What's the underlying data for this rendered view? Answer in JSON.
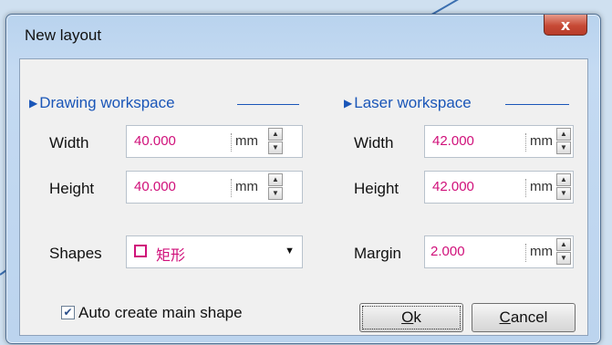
{
  "dialog": {
    "title": "New layout",
    "close_glyph": "x"
  },
  "drawing": {
    "section_label": "Drawing workspace",
    "width_label": "Width",
    "width_value": "40.000",
    "height_label": "Height",
    "height_value": "40.000",
    "unit": "mm",
    "shapes_label": "Shapes",
    "shapes_value": "矩形"
  },
  "laser": {
    "section_label": "Laser workspace",
    "width_label": "Width",
    "width_value": "42.000",
    "height_label": "Height",
    "height_value": "42.000",
    "margin_label": "Margin",
    "margin_value": "2.000",
    "unit": "mm"
  },
  "options": {
    "auto_create_label": "Auto create main shape",
    "auto_create_checked": true
  },
  "buttons": {
    "ok_mnemonic": "O",
    "ok_rest": "k",
    "cancel_mnemonic": "C",
    "cancel_rest": "ancel"
  },
  "colors": {
    "accent": "#1a56b8",
    "value_text": "#d0107a",
    "close_button": "#c74a36"
  },
  "icons": {
    "section_marker": "triangle-right-icon",
    "dropdown": "caret-down-icon",
    "spinner": "spin-arrows-icon"
  }
}
